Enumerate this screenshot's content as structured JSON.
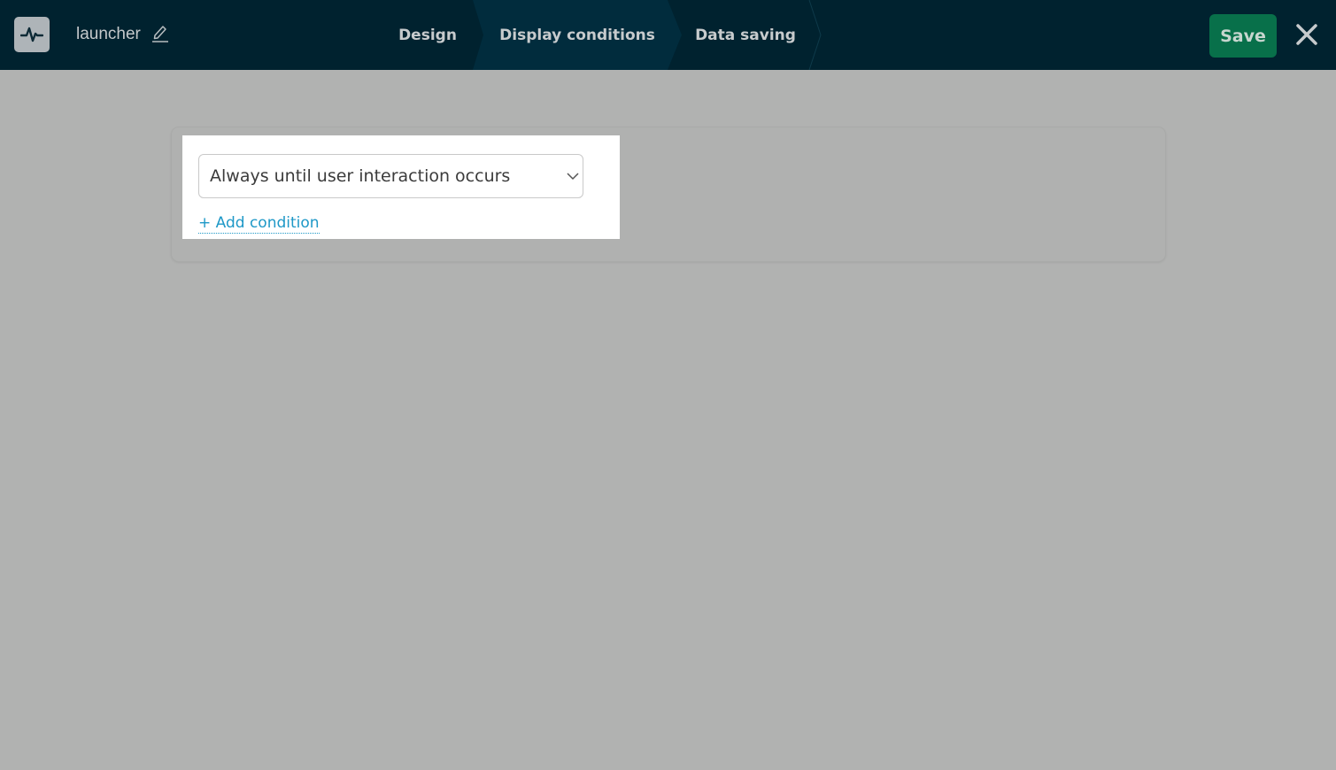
{
  "header": {
    "app_icon": "pulse-icon",
    "name": "launcher",
    "edit_icon": "pencil-icon",
    "tabs": [
      {
        "label": "Design",
        "active": false
      },
      {
        "label": "Display conditions",
        "active": true
      },
      {
        "label": "Data saving",
        "active": false
      }
    ],
    "save_label": "Save",
    "close_icon": "close-icon"
  },
  "conditions": {
    "selected": "Always until user interaction occurs",
    "add_label": "+ Add condition"
  },
  "colors": {
    "topbar": "#00222f",
    "active_tab": "#012c3d",
    "save_button": "#08704a",
    "link": "#1e98c7",
    "background": "#b1b2b1"
  }
}
